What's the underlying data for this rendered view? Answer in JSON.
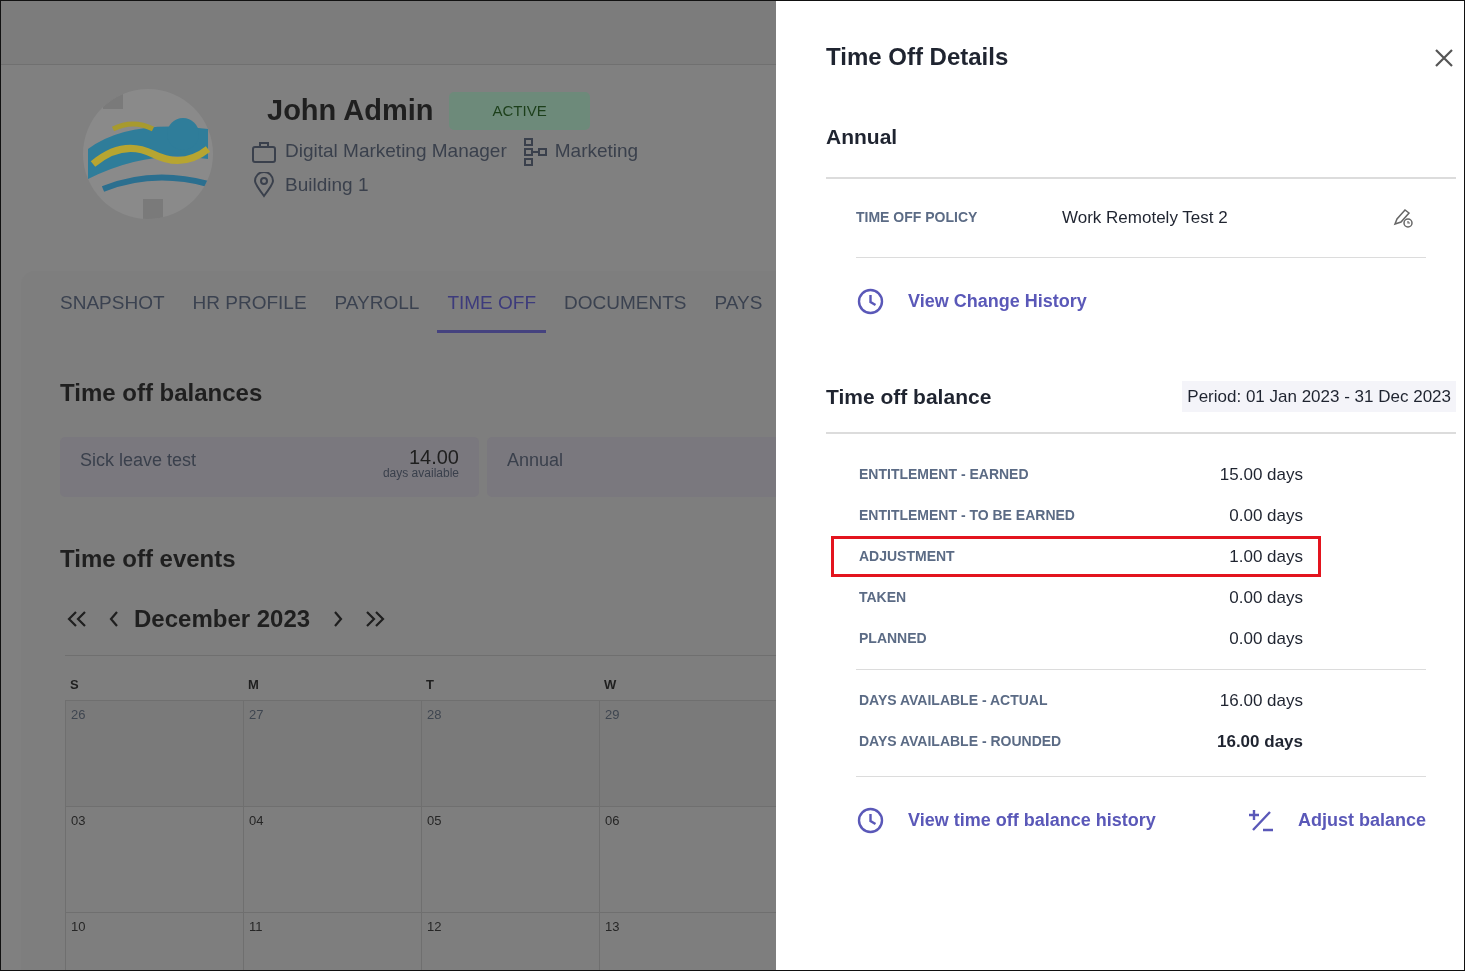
{
  "profile": {
    "name": "John Admin",
    "status": "ACTIVE",
    "job_title": "Digital Marketing Manager",
    "department": "Marketing",
    "location": "Building 1"
  },
  "tabs": [
    {
      "label": "SNAPSHOT",
      "selected": false
    },
    {
      "label": "HR PROFILE",
      "selected": false
    },
    {
      "label": "PAYROLL",
      "selected": false
    },
    {
      "label": "TIME OFF",
      "selected": true
    },
    {
      "label": "DOCUMENTS",
      "selected": false
    },
    {
      "label": "PAYS",
      "selected": false
    }
  ],
  "balances": {
    "heading": "Time off balances",
    "cards": [
      {
        "name": "Sick leave test",
        "value": "14.00",
        "unit": "days available"
      },
      {
        "name": "Annual"
      }
    ]
  },
  "events": {
    "heading": "Time off events",
    "calendar": {
      "month": "December 2023",
      "weekdays": [
        "S",
        "M",
        "T",
        "W"
      ],
      "weeks": [
        [
          {
            "day": "26",
            "outside": true
          },
          {
            "day": "27",
            "outside": true
          },
          {
            "day": "28",
            "outside": true
          },
          {
            "day": "29",
            "outside": true
          }
        ],
        [
          {
            "day": "03",
            "outside": false
          },
          {
            "day": "04",
            "outside": false
          },
          {
            "day": "05",
            "outside": false
          },
          {
            "day": "06",
            "outside": false
          }
        ],
        [
          {
            "day": "10",
            "outside": false
          },
          {
            "day": "11",
            "outside": false
          },
          {
            "day": "12",
            "outside": false
          },
          {
            "day": "13",
            "outside": false
          }
        ]
      ]
    }
  },
  "drawer": {
    "title": "Time Off Details",
    "policy_type": "Annual",
    "policy": {
      "label": "TIME OFF POLICY",
      "value": "Work Remotely Test 2"
    },
    "change_history_link": "View Change History",
    "balance": {
      "heading": "Time off balance",
      "period": "Period: 01 Jan 2023 - 31 Dec 2023",
      "rows": [
        {
          "label": "ENTITLEMENT - EARNED",
          "value": "15.00 days",
          "kind": "plain",
          "highlighted": false
        },
        {
          "label": "ENTITLEMENT - TO BE EARNED",
          "value": "0.00 days",
          "kind": "plain",
          "highlighted": false
        },
        {
          "label": "ADJUSTMENT",
          "value": "1.00 days",
          "kind": "plain",
          "highlighted": true
        },
        {
          "label": "TAKEN",
          "value": "0.00 days",
          "kind": "plain",
          "highlighted": false
        },
        {
          "label": "PLANNED",
          "value": "0.00 days",
          "kind": "plain",
          "highlighted": false
        }
      ],
      "summary_rows": [
        {
          "label": "DAYS AVAILABLE - ACTUAL",
          "value": "16.00 days",
          "kind": "plain",
          "highlighted": false
        },
        {
          "label": "DAYS AVAILABLE - ROUNDED",
          "value": "16.00 days",
          "kind": "strong",
          "highlighted": false
        }
      ]
    },
    "history_link": "View time off balance history",
    "adjust_link": "Adjust balance"
  }
}
